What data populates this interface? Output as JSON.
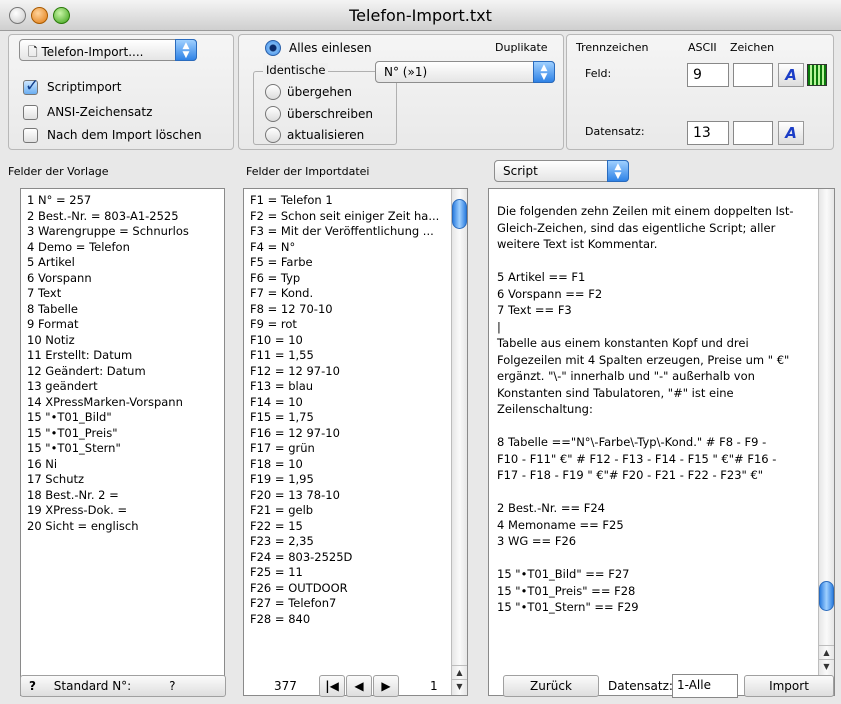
{
  "window": {
    "title": "Telefon-Import.txt"
  },
  "left_panel": {
    "file_popup": "Telefon-Import....",
    "options": [
      {
        "label": "Scriptimport",
        "checked": true
      },
      {
        "label": "ANSI-Zeichensatz",
        "checked": false
      },
      {
        "label": "Nach dem Import löschen",
        "checked": false
      }
    ]
  },
  "mid_panel": {
    "read_all_label": "Alles einlesen",
    "duplicates_label": "Duplikate",
    "identical_label": "Identische",
    "id_popup": "N° (»1)",
    "radios": [
      "übergehen",
      "überschreiben",
      "aktualisieren"
    ]
  },
  "right_panel": {
    "separator_label": "Trennzeichen",
    "ascii_label": "ASCII",
    "chars_label": "Zeichen",
    "field_label": "Feld:",
    "field_ascii": "9",
    "record_label": "Datensatz:",
    "record_ascii": "13",
    "a_glyph": "A"
  },
  "columns": {
    "template_fields_header": "Felder der Vorlage",
    "import_fields_header": "Felder der Importdatei",
    "mode_popup": "Script"
  },
  "template_fields": [
    " 1 N° = 257",
    " 2 Best.-Nr. = 803-A1-2525",
    " 3 Warengruppe = Schnurlos",
    " 4 Demo = Telefon",
    " 5 Artikel",
    " 6 Vorspann",
    " 7 Text",
    " 8 Tabelle",
    " 9 Format",
    "10 Notiz",
    "11 Erstellt: Datum",
    "12 Geändert: Datum",
    "13 geändert",
    "14 XPressMarken-Vorspann",
    "15 \"•T01_Bild\"",
    "15 \"•T01_Preis\"",
    "15 \"•T01_Stern\"",
    "16 Ni",
    "17 Schutz",
    "18 Best.-Nr. 2 =",
    "19 XPress-Dok. =",
    "20 Sicht = englisch"
  ],
  "import_fields": [
    "F1 = Telefon 1",
    "F2 = Schon seit einiger Zeit ha...",
    "F3 = Mit der Veröffentlichung ...",
    "F4 = N°",
    "F5 = Farbe",
    "F6 = Typ",
    "F7 = Kond.",
    "F8 = 12 70-10",
    "F9 = rot",
    "F10 = 10",
    "F11 = 1,55",
    "F12 = 12 97-10",
    "F13 = blau",
    "F14 = 10",
    "F15 = 1,75",
    "F16 = 12 97-10",
    "F17 = grün",
    "F18 = 10",
    "F19 = 1,95",
    "F20 = 13 78-10",
    "F21 = gelb",
    "F22 = 15",
    "F23 = 2,35",
    "F24 = 803-2525D",
    "F25 = 11",
    "F26 = OUTDOOR",
    "F27 = Telefon7",
    "F28 = 840"
  ],
  "script_lines": [
    "Die folgenden zehn Zeilen mit einem doppelten Ist-",
    "Gleich-Zeichen, sind das eigentliche Script; aller",
    "weitere Text ist Kommentar.",
    "",
    "5  Artikel == F1",
    "6  Vorspann == F2",
    "7  Text == F3",
    "|",
    "Tabelle aus einem konstanten Kopf und drei",
    "Folgezeilen mit 4 Spalten erzeugen, Preise um \" €\"",
    "ergänzt. \"\\-\" innerhalb und \"-\" außerhalb von",
    "Konstanten sind Tabulatoren, \"#\" ist eine",
    "Zeilenschaltung:",
    "",
    "8  Tabelle ==\"N°\\-Farbe\\-Typ\\-Kond.\" # F8 - F9 -",
    "F10 - F11\" €\" # F12 - F13 - F14 - F15 \" €\"# F16 -",
    "F17 - F18 - F19 \" €\"# F20 - F21 - F22 - F23\" €\"",
    "",
    "2 Best.-Nr. == F24",
    "4 Memoname == F25",
    "3 WG == F26",
    "",
    "15 \"•T01_Bild\" == F27",
    "15 \"•T01_Preis\" == F28",
    "15 \"•T01_Stern\" == F29"
  ],
  "bottom": {
    "help": "?",
    "standard_label": "Standard N°:",
    "standard_value": "?",
    "record_count": "377",
    "record_index": "1",
    "back_label": "Zurück",
    "dataset_label": "Datensatz:",
    "dataset_value": "1-Alle",
    "import_label": "Import"
  }
}
